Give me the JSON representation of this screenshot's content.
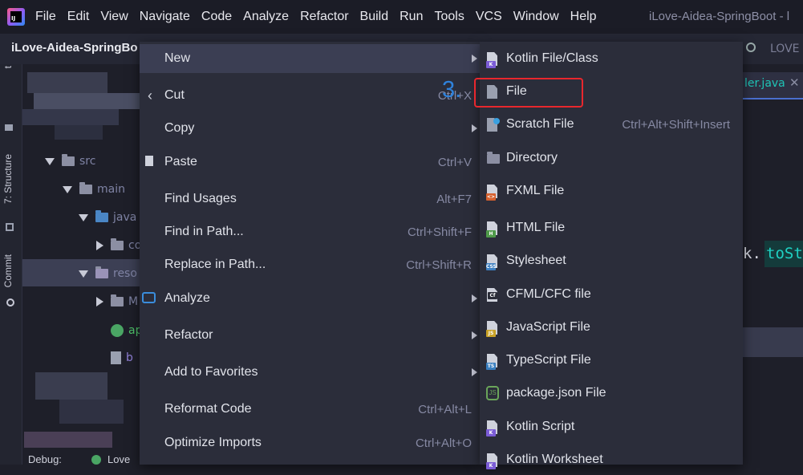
{
  "menubar": {
    "items": [
      "File",
      "Edit",
      "View",
      "Navigate",
      "Code",
      "Analyze",
      "Refactor",
      "Build",
      "Run",
      "Tools",
      "VCS",
      "Window",
      "Help"
    ],
    "window_title": "iLove-Aidea-SpringBoot - l"
  },
  "project": {
    "name": "iLove-Aidea-SpringBo"
  },
  "tool_rail": {
    "structure_label": "7: Structure",
    "commit_label": "Commit",
    "top_label": "t"
  },
  "tree": {
    "src": "src",
    "main": "main",
    "java": "java",
    "co": "co",
    "resources": "reso",
    "m_folder": "M",
    "app_file": "ap",
    "b_file": "b"
  },
  "editor": {
    "tab_label": "ler.java",
    "top_tab_label": "LOVE",
    "code_prefix": "k.",
    "code_token": "toSt"
  },
  "context_menu": {
    "items": [
      {
        "label": "New",
        "shortcut": "",
        "submenu": true
      },
      {
        "label": "Cut",
        "shortcut": "Ctrl+X",
        "submenu": false
      },
      {
        "label": "Copy",
        "shortcut": "",
        "submenu": true
      },
      {
        "label": "Paste",
        "shortcut": "Ctrl+V",
        "submenu": false
      },
      {
        "label": "Find Usages",
        "shortcut": "Alt+F7",
        "submenu": false
      },
      {
        "label": "Find in Path...",
        "shortcut": "Ctrl+Shift+F",
        "submenu": false
      },
      {
        "label": "Replace in Path...",
        "shortcut": "Ctrl+Shift+R",
        "submenu": false
      },
      {
        "label": "Analyze",
        "shortcut": "",
        "submenu": true
      },
      {
        "label": "Refactor",
        "shortcut": "",
        "submenu": true
      },
      {
        "label": "Add to Favorites",
        "shortcut": "",
        "submenu": true
      },
      {
        "label": "Reformat Code",
        "shortcut": "Ctrl+Alt+L",
        "submenu": false
      },
      {
        "label": "Optimize Imports",
        "shortcut": "Ctrl+Alt+O",
        "submenu": false
      }
    ]
  },
  "new_submenu": {
    "items": [
      {
        "label": "Kotlin File/Class",
        "shortcut": ""
      },
      {
        "label": "File",
        "shortcut": ""
      },
      {
        "label": "Scratch File",
        "shortcut": "Ctrl+Alt+Shift+Insert"
      },
      {
        "label": "Directory",
        "shortcut": ""
      },
      {
        "label": "FXML File",
        "shortcut": ""
      },
      {
        "label": "HTML File",
        "shortcut": ""
      },
      {
        "label": "Stylesheet",
        "shortcut": ""
      },
      {
        "label": "CFML/CFC file",
        "shortcut": ""
      },
      {
        "label": "JavaScript File",
        "shortcut": ""
      },
      {
        "label": "TypeScript File",
        "shortcut": ""
      },
      {
        "label": "package.json File",
        "shortcut": ""
      },
      {
        "label": "Kotlin Script",
        "shortcut": ""
      },
      {
        "label": "Kotlin Worksheet",
        "shortcut": ""
      }
    ]
  },
  "annotation": {
    "step_label": "3."
  },
  "bottom": {
    "debug_label": "Debug:",
    "run_label": "Love"
  },
  "colors": {
    "accent": "#2f82dc",
    "highlight_box": "#e8272d",
    "menu_bg": "#2b2d3a",
    "menu_active": "#3b3e53"
  }
}
